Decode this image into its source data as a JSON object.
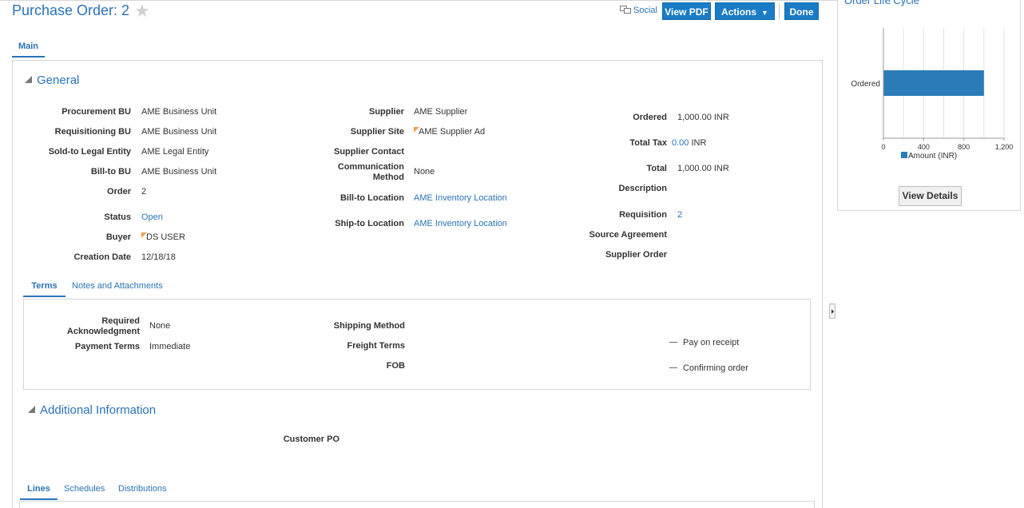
{
  "header": {
    "title": "Purchase Order: 2",
    "social_label": "Social",
    "view_pdf_label": "View PDF",
    "actions_label": "Actions",
    "done_label": "Done"
  },
  "main_tab": "Main",
  "general": {
    "heading": "General",
    "col1": [
      {
        "label": "Procurement BU",
        "value": "AME Business Unit"
      },
      {
        "label": "Requisitioning BU",
        "value": "AME Business Unit"
      },
      {
        "label": "Sold-to Legal Entity",
        "value": "AME Legal Entity"
      },
      {
        "label": "Bill-to BU",
        "value": "AME Business Unit"
      },
      {
        "label": "Order",
        "value": "2"
      },
      {
        "label": "Status",
        "value": "Open"
      },
      {
        "label": "Buyer",
        "value": "DS USER"
      },
      {
        "label": "Creation Date",
        "value": "12/18/18"
      }
    ],
    "col2": [
      {
        "label": "Supplier",
        "value": "AME Supplier"
      },
      {
        "label": "Supplier Site",
        "value": "AME Supplier Ad"
      },
      {
        "label": "Supplier Contact",
        "value": ""
      },
      {
        "label_line1": "Communication",
        "label_line2": "Method",
        "value": "None"
      },
      {
        "label": "Bill-to Location",
        "value": "AME Inventory Location"
      },
      {
        "label": "Ship-to Location",
        "value": "AME Inventory Location"
      }
    ],
    "col3": {
      "ordered_label": "Ordered",
      "ordered_value": "1,000.00 INR",
      "total_tax_label": "Total Tax",
      "total_tax_amount": "0.00",
      "total_tax_currency": "INR",
      "total_label": "Total",
      "total_value": "1,000.00 INR",
      "description_label": "Description",
      "requisition_label": "Requisition",
      "requisition_value": "2",
      "source_agreement_label": "Source Agreement",
      "supplier_order_label": "Supplier Order"
    }
  },
  "subtabs": {
    "terms": "Terms",
    "notes": "Notes and Attachments"
  },
  "terms": {
    "required_ack_line1": "Required",
    "required_ack_line2": "Acknowledgment",
    "required_ack_value": "None",
    "payment_terms_label": "Payment Terms",
    "payment_terms_value": "Immediate",
    "shipping_method_label": "Shipping Method",
    "freight_terms_label": "Freight Terms",
    "fob_label": "FOB",
    "pay_on_receipt": "Pay on receipt",
    "confirming_order": "Confirming order"
  },
  "additional": {
    "heading": "Additional Information",
    "customer_po_label": "Customer PO"
  },
  "bottom_tabs": {
    "lines": "Lines",
    "schedules": "Schedules",
    "distributions": "Distributions"
  },
  "side_panel": {
    "title": "Order Life Cycle",
    "view_details_label": "View Details"
  },
  "colors": {
    "accent": "#2a73b8",
    "bar": "#2b7bb9",
    "button": "#1a7bc6"
  },
  "chart_data": {
    "type": "bar",
    "orientation": "horizontal",
    "categories": [
      "Ordered"
    ],
    "series": [
      {
        "name": "Amount (INR)",
        "values": [
          1000
        ]
      }
    ],
    "xlim": [
      0,
      1200
    ],
    "xticks": [
      0,
      400,
      800,
      1200
    ],
    "xtick_labels": [
      "0",
      "400",
      "800",
      "1,200"
    ],
    "grid": true,
    "legend": "bottom"
  }
}
